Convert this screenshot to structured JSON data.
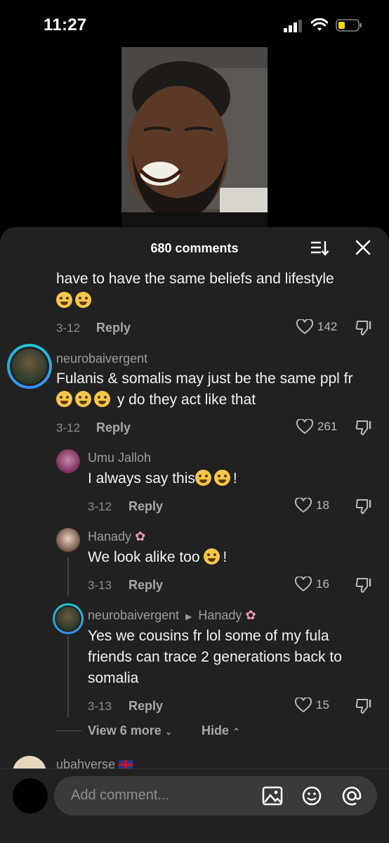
{
  "status": {
    "time": "11:27"
  },
  "sheet": {
    "comment_count": "680 comments"
  },
  "comments": [
    {
      "text_line1": "have to have the same beliefs and lifestyle",
      "date": "3-12",
      "reply_label": "Reply",
      "likes": "142"
    },
    {
      "username": "neurobaivergent",
      "text_line1": "Fulanis & somalis may just be the same ppl fr",
      "text_line2": "y do they act like that",
      "date": "3-12",
      "reply_label": "Reply",
      "likes": "261"
    }
  ],
  "replies": [
    {
      "username": "Umu Jalloh",
      "text": "I always say this",
      "text_end": "!",
      "date": "3-12",
      "reply_label": "Reply",
      "likes": "18"
    },
    {
      "username": "Hanady",
      "text": "We look alike too",
      "text_end": "!",
      "date": "3-13",
      "reply_label": "Reply",
      "likes": "16"
    },
    {
      "username": "neurobaivergent",
      "reply_to": "Hanady",
      "text_line1": "Yes we cousins fr lol some of my fula",
      "text_line2": "friends can trace 2 generations back to",
      "text_line3": "somalia",
      "date": "3-13",
      "reply_label": "Reply",
      "likes": "15"
    }
  ],
  "thread_controls": {
    "view_more": "View 6 more",
    "hide": "Hide"
  },
  "next_comment": {
    "username": "ubahverse"
  },
  "input": {
    "placeholder": "Add comment..."
  },
  "icons": [
    "signal-icon",
    "wifi-icon",
    "battery-icon",
    "sort-icon",
    "close-icon",
    "heart-icon",
    "dislike-icon",
    "image-icon",
    "sticker-icon",
    "at-icon",
    "chevron-down-icon",
    "chevron-up-icon",
    "flower-emoji-icon",
    "uk-flag-icon"
  ]
}
